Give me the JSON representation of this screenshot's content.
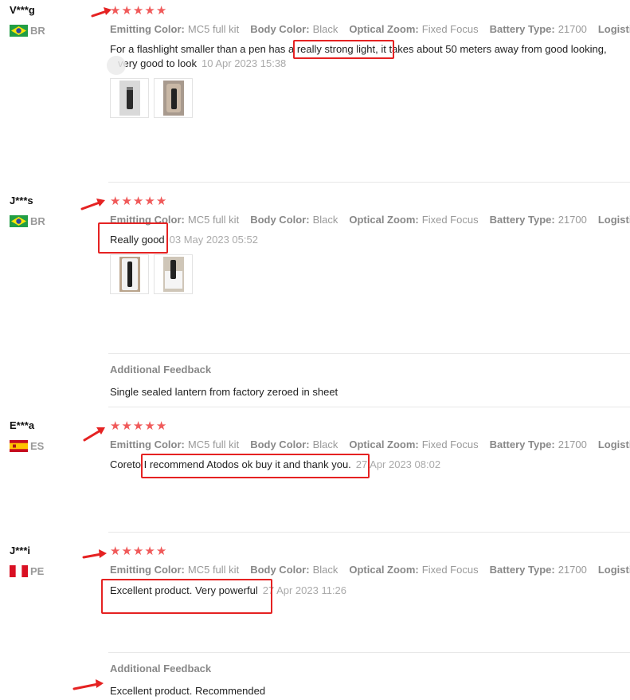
{
  "spec_labels": {
    "emitting_color": "Emitting Color:",
    "body_color": "Body Color:",
    "optical_zoom": "Optical Zoom:",
    "battery_type": "Battery Type:",
    "logistics": "Logistics:"
  },
  "reviews": [
    {
      "user": "V***g",
      "country": "BR",
      "flag_icon": "brazil-flag-icon",
      "rating": 5,
      "specs": {
        "emitting_color": "MC5 full kit",
        "body_color": "Black",
        "optical_zoom": "Fixed Focus",
        "battery_type": "21700"
      },
      "text_line1": "For a flashlight smaller than a pen has a really strong light, it takes about 50 meters away from good looking,",
      "text_line2": "very good to look",
      "date": "10 Apr 2023 15:38"
    },
    {
      "user": "J***s",
      "country": "BR",
      "flag_icon": "brazil-flag-icon",
      "rating": 5,
      "specs": {
        "emitting_color": "MC5 full kit",
        "body_color": "Black",
        "optical_zoom": "Fixed Focus",
        "battery_type": "21700"
      },
      "text": "Really good",
      "date": "03 May 2023 05:52",
      "additional_feedback_title": "Additional Feedback",
      "additional_feedback": "Single sealed lantern from factory zeroed in sheet"
    },
    {
      "user": "E***a",
      "country": "ES",
      "flag_icon": "spain-flag-icon",
      "rating": 5,
      "specs": {
        "emitting_color": "MC5 full kit",
        "body_color": "Black",
        "optical_zoom": "Fixed Focus",
        "battery_type": "21700"
      },
      "text": "Coreto I recommend Atodos ok buy it and thank you.",
      "date": "27 Apr 2023 08:02"
    },
    {
      "user": "J***i",
      "country": "PE",
      "flag_icon": "peru-flag-icon",
      "rating": 5,
      "specs": {
        "emitting_color": "MC5 full kit",
        "body_color": "Black",
        "optical_zoom": "Fixed Focus",
        "battery_type": "21700"
      },
      "text": "Excellent product. Very powerful",
      "date": "27 Apr 2023 11:26",
      "additional_feedback_title": "Additional Feedback",
      "additional_feedback": "Excellent product. Recommended"
    }
  ],
  "colors": {
    "star": "#f05a5a",
    "annotation": "#e52222",
    "muted": "#999999"
  }
}
